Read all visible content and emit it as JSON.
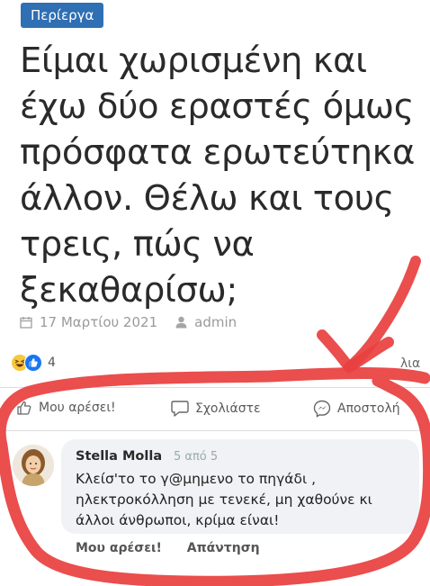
{
  "article": {
    "category": "Περίεργα",
    "title": "Είμαι χωρισμένη και έχω δύο εραστές όμως πρόσφατα ερωτεύτηκα άλλον. Θέλω και τους τρεις, πώς να ξεκαθαρίσω;",
    "date": "17 Μαρτίου 2021",
    "author": "admin"
  },
  "reactions": {
    "count": "4",
    "shares_partial": "λια",
    "icons": [
      "haha-icon",
      "like-icon"
    ]
  },
  "actions": {
    "like": "Μου αρέσει!",
    "comment": "Σχολιάστε",
    "send": "Αποστολή"
  },
  "comment": {
    "author": "Stella Molla",
    "rating": "5 από 5",
    "text": "Κλείσ'το το γ@μημενο το πηγάδι , ηλεκτροκόλληση με τενεκέ, μη χαθούνε κι άλλοι άνθρωποι, κρίμα είναι!",
    "like_link": "Μου αρέσει!",
    "reply_link": "Απάντηση"
  },
  "annotation_color": "#e8413f",
  "accent_color": "#2f6fb3"
}
